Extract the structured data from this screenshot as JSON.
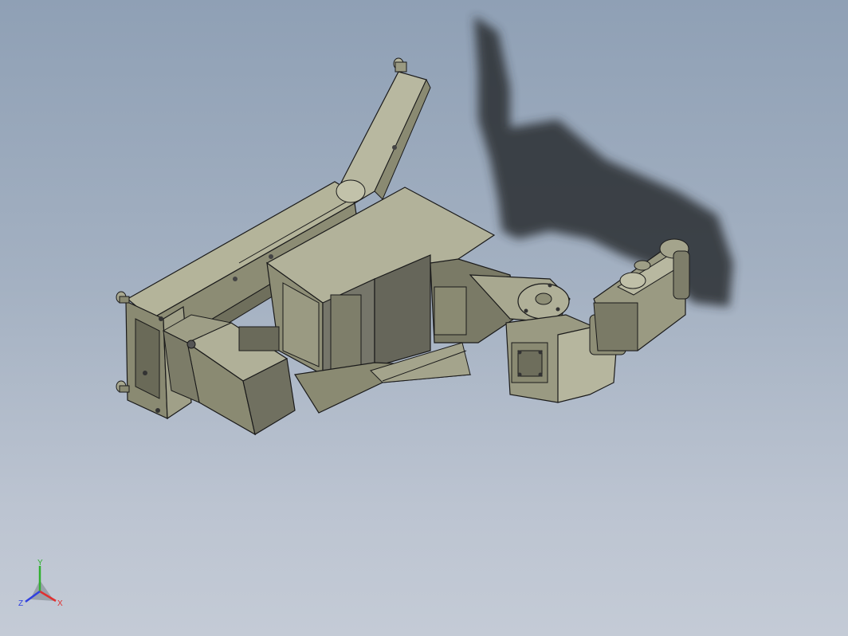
{
  "viewport": {
    "background_top": "#8fa0b5",
    "background_bottom": "#c4cbd6",
    "model_color": "#8a8a72",
    "edge_color": "#1a1a1a",
    "shadow_color": "#2a2d31"
  },
  "triad": {
    "x_label": "X",
    "y_label": "Y",
    "z_label": "Z",
    "x_color": "#e03030",
    "y_color": "#30b030",
    "z_color": "#3040e0"
  }
}
